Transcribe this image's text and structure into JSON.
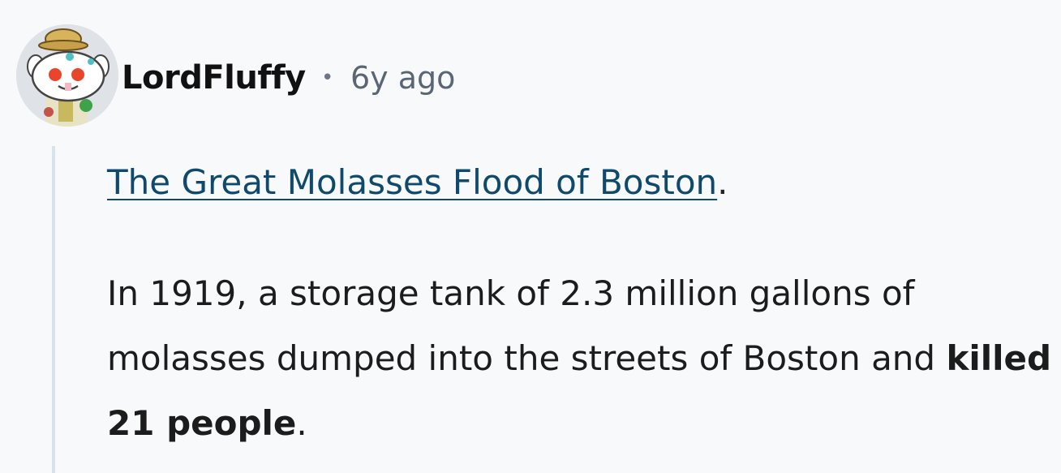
{
  "comment": {
    "author": "LordFluffy",
    "separator": "•",
    "timestamp": "6y ago",
    "link_text": "The Great Molasses Flood of Boston",
    "link_trailing": ".",
    "body_text_1": "In 1919, a storage tank of 2.3 million gallons of molasses dumped into the streets of Boston and ",
    "body_bold": "killed 21 people",
    "body_text_2": "."
  },
  "icons": {
    "avatar": "snoo-avatar-icon"
  },
  "colors": {
    "background": "#f8f9fb",
    "link": "#0f4a6c",
    "timestamp": "#5a6674",
    "thread_line": "#d9e2ec"
  }
}
